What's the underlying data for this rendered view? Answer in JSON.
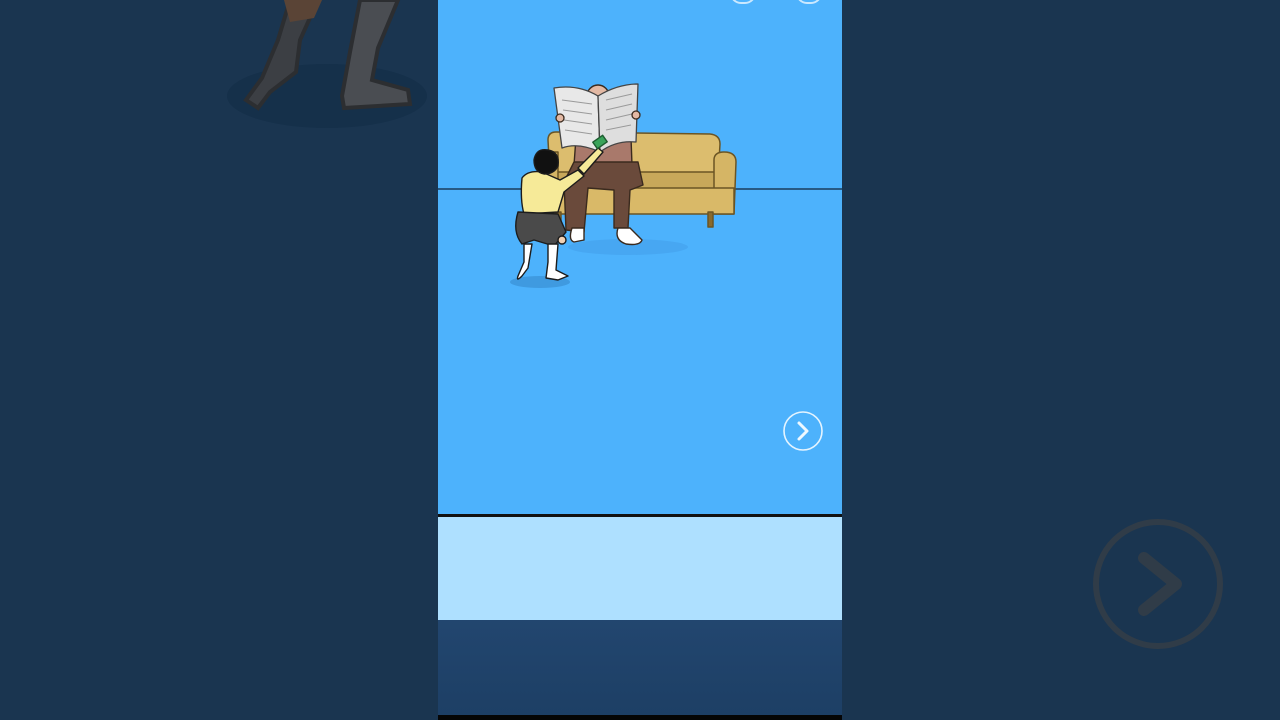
{
  "game": {
    "scene": "dad-reading-newspaper-on-sofa",
    "characters": [
      "dad",
      "boy"
    ],
    "props": [
      "sofa",
      "newspaper",
      "banknote"
    ],
    "next_icon": "chevron-right-icon",
    "colors": {
      "sky": "#4db2fc",
      "answer_area": "#aee0ff",
      "bottom_bar": "#1f426a",
      "side_background": "#1a3550",
      "sofa": "#dcbd6e"
    }
  }
}
